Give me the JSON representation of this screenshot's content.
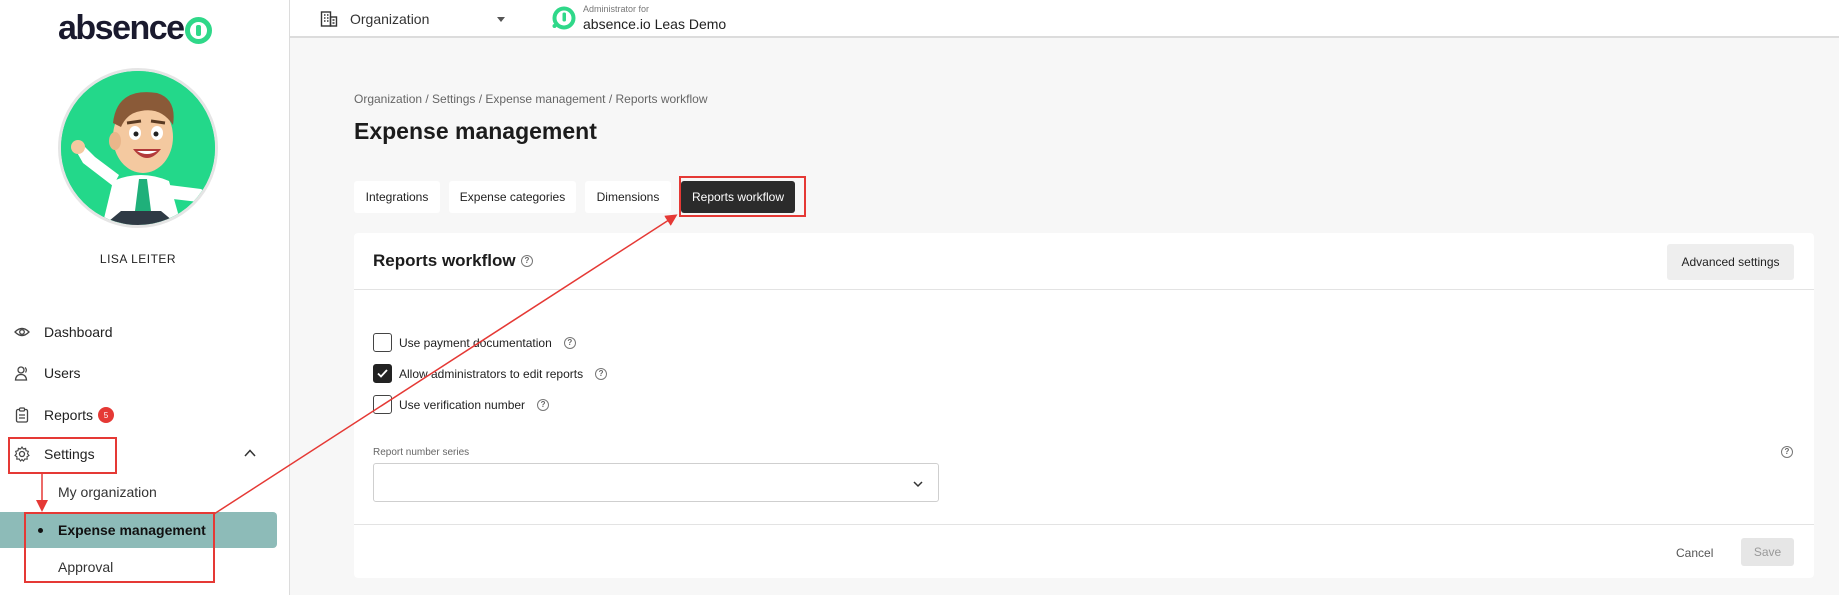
{
  "app": {
    "logo_text": "absence",
    "colors": {
      "brand_green": "#2fd889",
      "accent_teal": "#8dbbb8",
      "annotation_red": "#e53935"
    }
  },
  "sidebar": {
    "user_name": "LISA LEITER",
    "nav": [
      {
        "label": "Dashboard",
        "icon": "eye-icon"
      },
      {
        "label": "Users",
        "icon": "users-icon"
      },
      {
        "label": "Reports",
        "icon": "clipboard-icon",
        "badge": "5"
      },
      {
        "label": "Settings",
        "icon": "gear-icon"
      }
    ],
    "settings_sub": [
      {
        "label": "My organization"
      },
      {
        "label": "Expense management",
        "active": true
      },
      {
        "label": "Approval"
      }
    ]
  },
  "topbar": {
    "org_select": "Organization",
    "admin_small": "Administrator for",
    "admin_name": "absence.io Leas Demo"
  },
  "main": {
    "breadcrumb": "Organization / Settings / Expense management / Reports workflow",
    "title": "Expense management",
    "tabs": [
      {
        "label": "Integrations"
      },
      {
        "label": "Expense categories"
      },
      {
        "label": "Dimensions"
      },
      {
        "label": "Reports workflow",
        "active": true
      }
    ],
    "card": {
      "title": "Reports workflow",
      "advanced_button": "Advanced settings",
      "checkboxes": [
        {
          "label": "Use payment documentation",
          "checked": false
        },
        {
          "label": "Allow administrators to edit reports",
          "checked": true
        },
        {
          "label": "Use verification number",
          "checked": false
        }
      ],
      "report_number_label": "Report number series",
      "report_number_value": "",
      "cancel_label": "Cancel",
      "save_label": "Save"
    }
  }
}
